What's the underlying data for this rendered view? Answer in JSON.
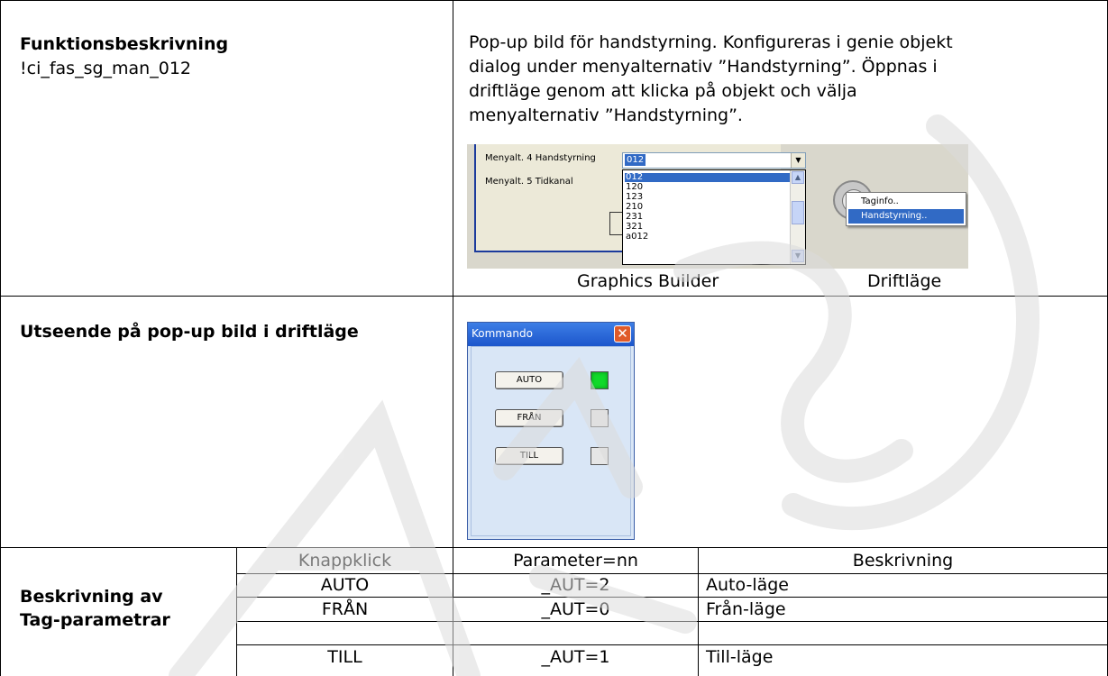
{
  "row1": {
    "title": "Funktionsbeskrivning",
    "code": "!ci_fas_sg_man_012",
    "description_lines": [
      "Pop-up bild för handstyrning. Konfigureras i genie objekt",
      "dialog under menyalternativ ”Handstyrning”. Öppnas i",
      "driftläge genom att klicka på objekt och välja",
      "menyalternativ ”Handstyrning”."
    ],
    "screenshot": {
      "label_menu4": "Menyalt. 4 Handstyrning",
      "label_menu5": "Menyalt. 5 Tidkanal",
      "combo_value": "012",
      "list_items": [
        "012",
        "120",
        "123",
        "210",
        "231",
        "321",
        "a012"
      ],
      "context_menu": [
        "Taginfo..",
        "Handstyrning.."
      ]
    },
    "caption_left": "Graphics Builder",
    "caption_right": "Driftläge"
  },
  "row2": {
    "title": "Utseende på pop-up bild i driftläge",
    "popup": {
      "window_title": "Kommando",
      "close_glyph": "✕",
      "buttons": [
        "AUTO",
        "FRÅN",
        "TILL"
      ],
      "indicator_states": [
        "on",
        "off",
        "off"
      ]
    }
  },
  "row3": {
    "title_line1": "Beskrivning av",
    "title_line2": "Tag-parametrar",
    "headers": [
      "Knappklick",
      "Parameter=nn",
      "Beskrivning"
    ],
    "rows": [
      [
        "AUTO",
        "_AUT=2",
        "Auto-läge"
      ],
      [
        "FRÅN",
        "_AUT=0",
        "Från-läge"
      ],
      [
        "TILL",
        "_AUT=1",
        "Till-läge"
      ]
    ]
  },
  "colors": {
    "popup_background": "#d9e6f6",
    "title_bar": "#1c56cc",
    "indicator_on": "#11d92a",
    "selection": "#316ac5"
  }
}
